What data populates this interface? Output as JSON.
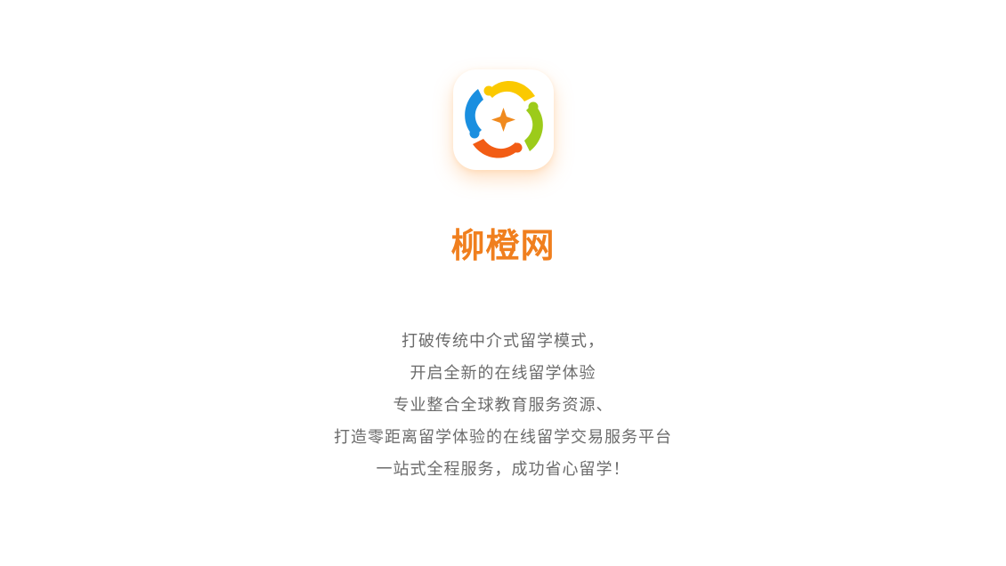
{
  "app": {
    "name": "柳橙网",
    "name_color": "#f07f1e",
    "icon_name": "liucheng-logo-icon",
    "brand_colors": {
      "yellow": "#fbc900",
      "green": "#9ccb1a",
      "orange": "#f25c14",
      "blue": "#1a8fe0",
      "star": "#f08a1e"
    }
  },
  "description": {
    "lines": [
      "打破传统中介式留学模式，",
      "开启全新的在线留学体验",
      "专业整合全球教育服务资源、",
      "打造零距离留学体验的在线留学交易服务平台",
      "一站式全程服务，成功省心留学！"
    ]
  }
}
